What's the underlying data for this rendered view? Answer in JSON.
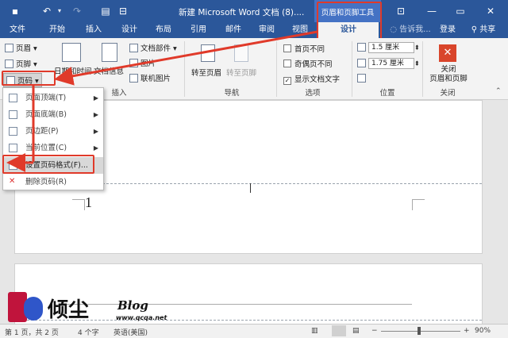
{
  "title": {
    "doc_title": "新建 Microsoft Word 文档 (8)....",
    "context_tool": "页眉和页脚工具"
  },
  "window_buttons": {
    "min": "—",
    "restore": "▭",
    "close": "✕"
  },
  "tabs": {
    "file": "文件",
    "home": "开始",
    "insert": "插入",
    "design": "设计",
    "layout": "布局",
    "references": "引用",
    "mailings": "邮件",
    "review": "审阅",
    "view": "视图",
    "context_design": "设计",
    "tell_me": "告诉我...",
    "login": "登录",
    "share": "共享"
  },
  "ribbon": {
    "header": "页眉",
    "footer": "页脚",
    "page_number": "页码",
    "date_time": "日期和时间",
    "doc_info": "文档信息",
    "doc_parts": "文档部件",
    "picture": "图片",
    "online_picture": "联机图片",
    "goto_header": "转至页眉",
    "goto_footer": "转至页脚",
    "first_page_diff": "首页不同",
    "odd_even_diff": "奇偶页不同",
    "show_doc_text": "显示文档文字",
    "header_pos": "1.5 厘米",
    "footer_pos": "1.75 厘米",
    "close_label": "关闭\n页眉和页脚",
    "group_insert": "插入",
    "group_nav": "导航",
    "group_options": "选项",
    "group_position": "位置",
    "group_close": "关闭"
  },
  "menu": [
    {
      "label": "页面顶端(T)",
      "arrow": "▶"
    },
    {
      "label": "页面底端(B)",
      "arrow": "▶"
    },
    {
      "label": "页边距(P)",
      "arrow": "▶"
    },
    {
      "label": "当前位置(C)",
      "arrow": "▶"
    },
    {
      "label": "设置页码格式(F)...",
      "arrow": ""
    },
    {
      "label": "删除页码(R)",
      "arrow": ""
    }
  ],
  "document": {
    "page_number": "1"
  },
  "watermark": {
    "brand": "倾尘",
    "blog": "Blog",
    "url": "www.qcqa.net"
  },
  "status": {
    "page": "第 1 页，共 2 页",
    "words": "4 个字",
    "lang": "英语(美国)",
    "zoom": "90%"
  }
}
